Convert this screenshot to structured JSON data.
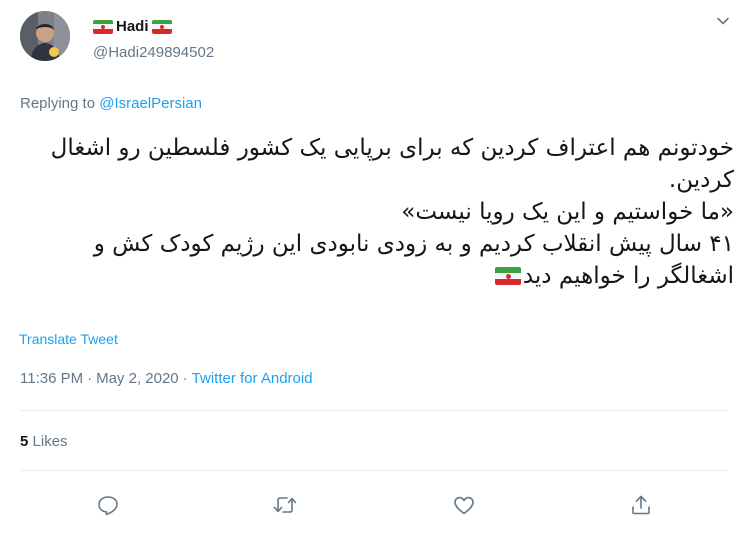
{
  "user": {
    "display_name": "Hadi",
    "handle": "@Hadi249894502",
    "avatar_icon": "user-avatar-photo",
    "flag_icon": "iran-flag-emoji"
  },
  "reply": {
    "prefix": "Replying to ",
    "mention": "@IsraelPersian"
  },
  "tweet": {
    "lines": [
      "خودتونم هم اعتراف کردین که برای برپایی یک کشور فلسطین رو اشغال کردین.",
      "«ما خواستیم و این یک رویا نیست»",
      "۴۱ سال پیش انقلاب کردیم و به زودی نابودی این رژیم کودک کش و اشغالگر را خواهیم دید"
    ],
    "trailing_icon": "iran-flag-emoji"
  },
  "translate_label": "Translate Tweet",
  "meta": {
    "time": "11:36 PM",
    "separator1": "·",
    "date": "May 2, 2020",
    "separator2": "·",
    "source": "Twitter for Android"
  },
  "stats": {
    "likes_count": "5",
    "likes_label": "Likes"
  },
  "actions": {
    "reply_icon": "reply-icon",
    "retweet_icon": "retweet-icon",
    "like_icon": "like-icon",
    "share_icon": "share-icon"
  },
  "colors": {
    "accent": "#1da1f2",
    "secondary_text": "#657786",
    "primary_text": "#14171a",
    "divider": "#e6ecf0"
  }
}
